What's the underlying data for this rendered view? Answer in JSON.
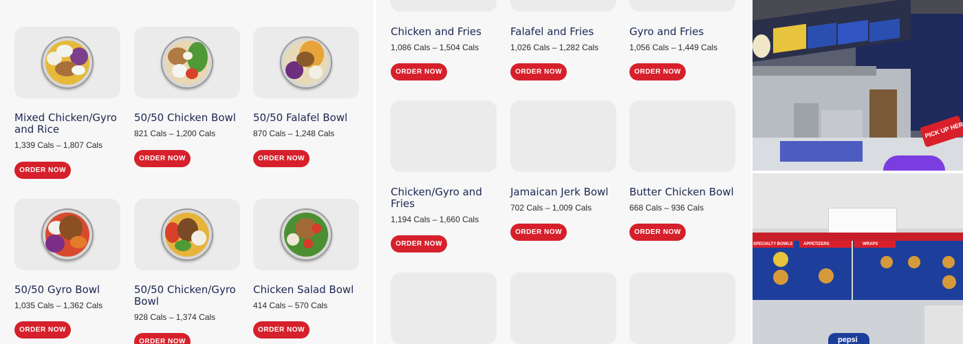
{
  "left_panel": {
    "items": [
      {
        "name": "Mixed Chicken/Gyro and Rice",
        "cals": "1,339 Cals – 1,807 Cals",
        "button": "ORDER NOW"
      },
      {
        "name": "50/50 Chicken Bowl",
        "cals": "821 Cals – 1,200 Cals",
        "button": "ORDER NOW"
      },
      {
        "name": "50/50 Falafel Bowl",
        "cals": "870 Cals – 1,248 Cals",
        "button": "ORDER NOW"
      },
      {
        "name": "50/50 Gyro Bowl",
        "cals": "1,035 Cals – 1,362 Cals",
        "button": "ORDER NOW"
      },
      {
        "name": "50/50 Chicken/Gyro Bowl",
        "cals": "928 Cals – 1,374 Cals",
        "button": "ORDER NOW"
      },
      {
        "name": "Chicken Salad Bowl",
        "cals": "414 Cals – 570 Cals",
        "button": "ORDER NOW"
      }
    ]
  },
  "middle_panel": {
    "items": [
      {
        "name": "Chicken and Fries",
        "cals": "1,086 Cals – 1,504 Cals",
        "button": "ORDER NOW"
      },
      {
        "name": "Falafel and Fries",
        "cals": "1,026 Cals – 1,282 Cals",
        "button": "ORDER NOW"
      },
      {
        "name": "Gyro and Fries",
        "cals": "1,056 Cals – 1,449 Cals",
        "button": "ORDER NOW"
      },
      {
        "name": "Chicken/Gyro and Fries",
        "cals": "1,194 Cals – 1,660 Cals",
        "button": "ORDER NOW"
      },
      {
        "name": "Jamaican Jerk Bowl",
        "cals": "702 Cals – 1,009 Cals",
        "button": "ORDER NOW"
      },
      {
        "name": "Butter Chicken Bowl",
        "cals": "668 Cals – 936 Cals",
        "button": "ORDER NOW"
      }
    ]
  },
  "right_panel": {
    "sign_text": "PICK UP HERE",
    "board_headers": [
      "SPECIALTY BOWLS",
      "APPETIZERS",
      "WRAPS"
    ],
    "cup_text": "pepsi"
  },
  "colors": {
    "accent": "#d6202b",
    "title": "#1c2551",
    "card_bg": "#ebebeb",
    "panel_bg": "#f7f7f7"
  }
}
